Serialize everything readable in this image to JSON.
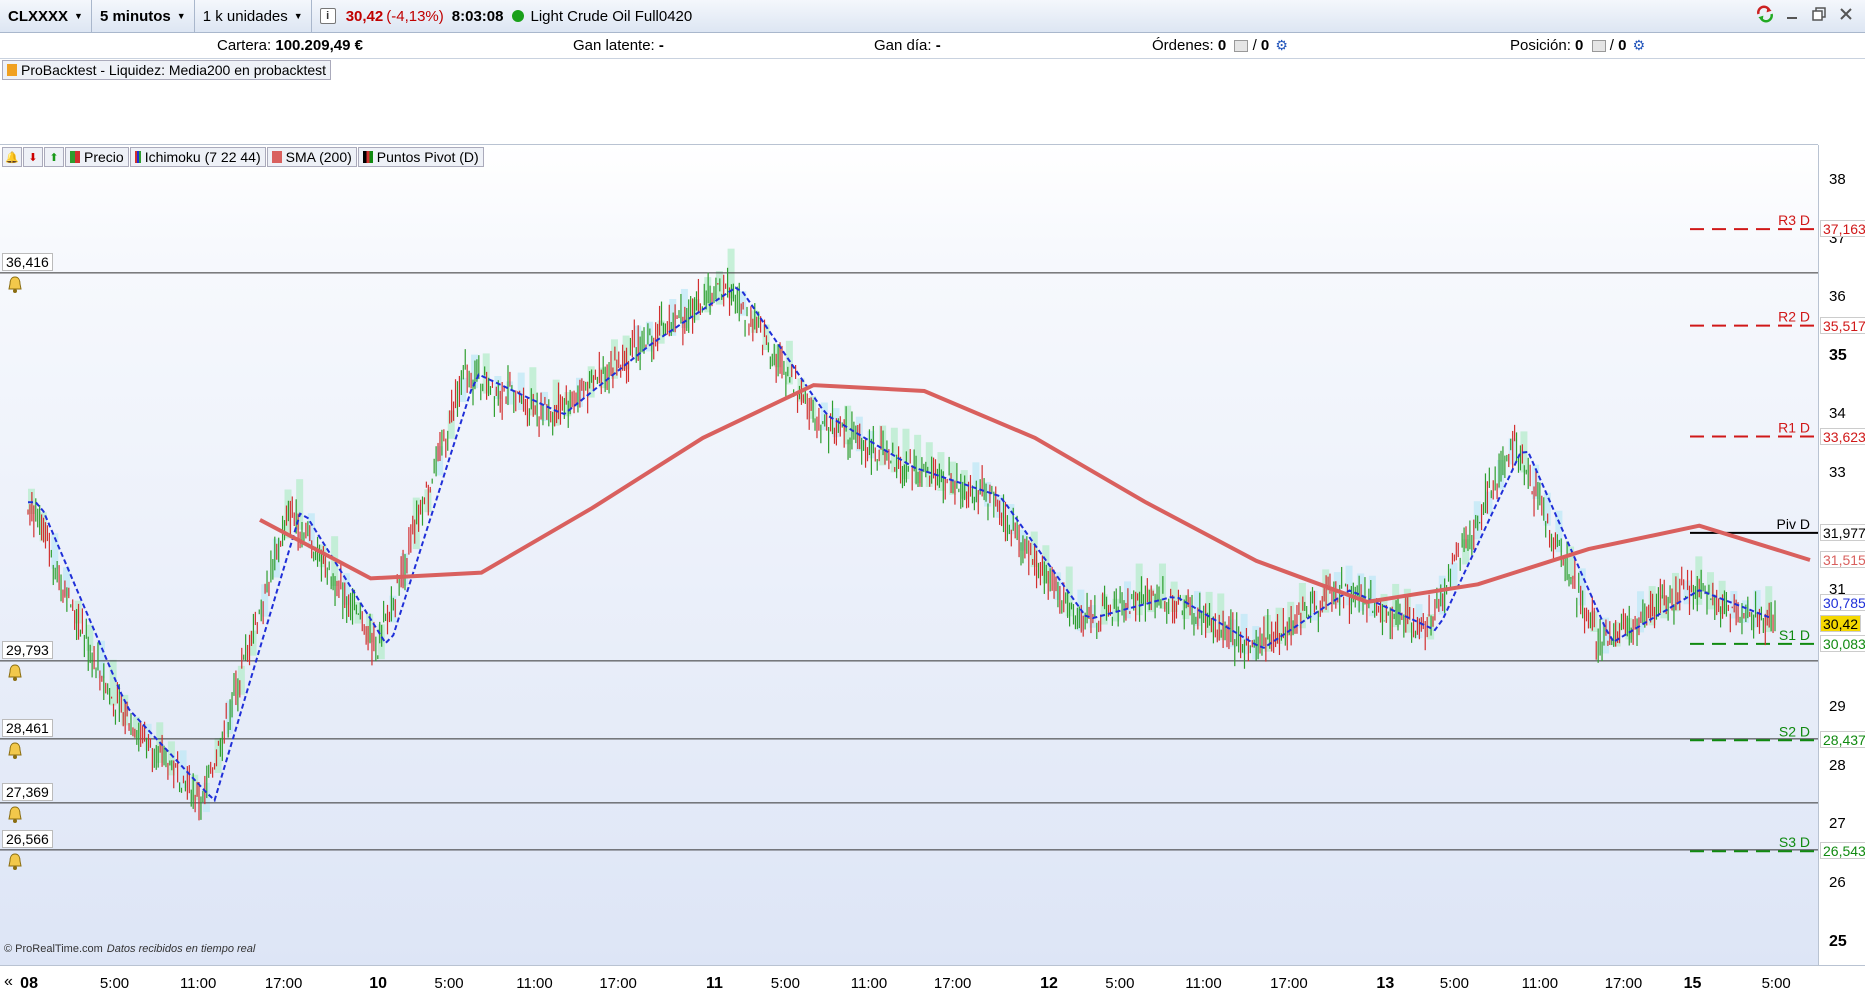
{
  "toolbar": {
    "symbol": "CLXXXX",
    "timeframe": "5 minutos",
    "units": "1 k unidades",
    "info_icon": "i",
    "price": "30,42",
    "change": "(-4,13%)",
    "time": "8:03:08",
    "instrument": "Light Crude Oil Full0420"
  },
  "account": {
    "cartera_label": "Cartera:",
    "cartera_value": "100.209,49 €",
    "gan_latente_label": "Gan latente:",
    "gan_latente_value": "-",
    "gan_dia_label": "Gan día:",
    "gan_dia_value": "-",
    "ordenes_label": "Órdenes:",
    "ordenes_value": "0",
    "ordenes_value2": "0",
    "posicion_label": "Posición:",
    "posicion_value": "0",
    "posicion_value2": "0",
    "sep": "/"
  },
  "indicator_panel": {
    "label": "ProBacktest - Liquidez: Media200 en probacktest"
  },
  "legend": {
    "precio": "Precio",
    "ichimoku": "Ichimoku (7 22 44)",
    "sma": "SMA (200)",
    "pivots": "Puntos Pivot (D)"
  },
  "alerts": [
    {
      "value": "36,416"
    },
    {
      "value": "29,793"
    },
    {
      "value": "28,461"
    },
    {
      "value": "27,369"
    },
    {
      "value": "26,566"
    }
  ],
  "price_axis": {
    "ticks": [
      {
        "label": "38",
        "bold": false,
        "v": 38
      },
      {
        "label": "37",
        "bold": false,
        "v": 37
      },
      {
        "label": "36",
        "bold": false,
        "v": 36
      },
      {
        "label": "35",
        "bold": true,
        "v": 35
      },
      {
        "label": "34",
        "bold": false,
        "v": 34
      },
      {
        "label": "33",
        "bold": false,
        "v": 33
      },
      {
        "label": "31",
        "bold": false,
        "v": 31
      },
      {
        "label": "29",
        "bold": false,
        "v": 29
      },
      {
        "label": "28",
        "bold": false,
        "v": 28
      },
      {
        "label": "27",
        "bold": false,
        "v": 27
      },
      {
        "label": "26",
        "bold": false,
        "v": 26
      },
      {
        "label": "25",
        "bold": true,
        "v": 25
      }
    ],
    "pivots": [
      {
        "name": "R3 D",
        "value": "37,163",
        "color": "#d01818"
      },
      {
        "name": "R2 D",
        "value": "35,517",
        "color": "#d01818"
      },
      {
        "name": "R1 D",
        "value": "33,623",
        "color": "#d01818"
      },
      {
        "name": "Piv D",
        "value": "31,977",
        "color": "#000000"
      },
      {
        "name": "S1 D",
        "value": "30,083",
        "color": "#108a10"
      },
      {
        "name": "S2 D",
        "value": "28,437",
        "color": "#108a10"
      },
      {
        "name": "S3 D",
        "value": "26,543",
        "color": "#108a10"
      }
    ],
    "sma_value": "31,515",
    "tenkan_value": "30,785",
    "last_price": "30,42"
  },
  "time_axis": {
    "labels": [
      {
        "t": "08",
        "bold": true,
        "p": 0.016
      },
      {
        "t": "5:00",
        "bold": false,
        "p": 0.063
      },
      {
        "t": "11:00",
        "bold": false,
        "p": 0.109
      },
      {
        "t": "17:00",
        "bold": false,
        "p": 0.156
      },
      {
        "t": "10",
        "bold": true,
        "p": 0.208
      },
      {
        "t": "5:00",
        "bold": false,
        "p": 0.247
      },
      {
        "t": "11:00",
        "bold": false,
        "p": 0.294
      },
      {
        "t": "17:00",
        "bold": false,
        "p": 0.34
      },
      {
        "t": "11",
        "bold": true,
        "p": 0.393
      },
      {
        "t": "5:00",
        "bold": false,
        "p": 0.432
      },
      {
        "t": "11:00",
        "bold": false,
        "p": 0.478
      },
      {
        "t": "17:00",
        "bold": false,
        "p": 0.524
      },
      {
        "t": "12",
        "bold": true,
        "p": 0.577
      },
      {
        "t": "5:00",
        "bold": false,
        "p": 0.616
      },
      {
        "t": "11:00",
        "bold": false,
        "p": 0.662
      },
      {
        "t": "17:00",
        "bold": false,
        "p": 0.709
      },
      {
        "t": "13",
        "bold": true,
        "p": 0.762
      },
      {
        "t": "5:00",
        "bold": false,
        "p": 0.8
      },
      {
        "t": "11:00",
        "bold": false,
        "p": 0.847
      },
      {
        "t": "17:00",
        "bold": false,
        "p": 0.893
      },
      {
        "t": "15",
        "bold": true,
        "p": 0.931
      },
      {
        "t": "5:00",
        "bold": false,
        "p": 0.977
      }
    ]
  },
  "footer": {
    "brand": "© ProRealTime.com",
    "note": "Datos recibidos en tiempo real"
  },
  "colors": {
    "sma": "#d9605e",
    "tenkan": "#1f2fd8",
    "bull": "#2e9e2e",
    "bear": "#d23030",
    "cloud_bull": "#b5eccb",
    "cloud_bear": "#bfe8f5"
  },
  "chart_data": {
    "type": "line",
    "title": "",
    "ylim": [
      24.6,
      38.6
    ],
    "x": [
      "08",
      "10",
      "11",
      "12",
      "13",
      "15"
    ],
    "series": [
      {
        "name": "Precio",
        "values": [
          32.5,
          29.0,
          27.4,
          32.4,
          30.0,
          34.7,
          34.0,
          35.2,
          36.2,
          34.0,
          33.1,
          32.6,
          30.5,
          30.9,
          30.0,
          31.0,
          30.3,
          33.5,
          30.1,
          31.0,
          30.42
        ]
      },
      {
        "name": "SMA (200)",
        "values": [
          32.2,
          31.2,
          31.3,
          32.4,
          33.6,
          34.5,
          34.4,
          33.6,
          32.5,
          31.5,
          30.8,
          31.1,
          31.7,
          32.1,
          31.515
        ]
      }
    ]
  }
}
